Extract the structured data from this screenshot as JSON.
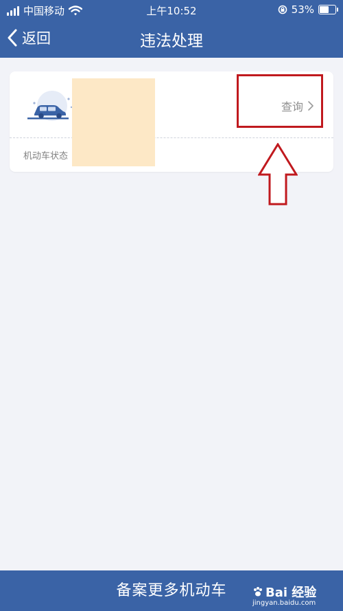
{
  "status_bar": {
    "carrier": "中国移动",
    "time": "上午10:52",
    "battery_percent": "53%",
    "battery_level": 0.53
  },
  "nav": {
    "back_label": "返回",
    "title": "违法处理"
  },
  "vehicle_card": {
    "query_label": "查询",
    "status_label": "机动车状态"
  },
  "bottom_bar": {
    "button_label": "备案更多机动车"
  },
  "watermark": {
    "brand": "Bai 经验",
    "url": "jingyan.baidu.com"
  },
  "colors": {
    "primary": "#3a63a6",
    "background": "#f2f3f8",
    "highlight": "#c0191e",
    "mask": "#fde8c6"
  }
}
